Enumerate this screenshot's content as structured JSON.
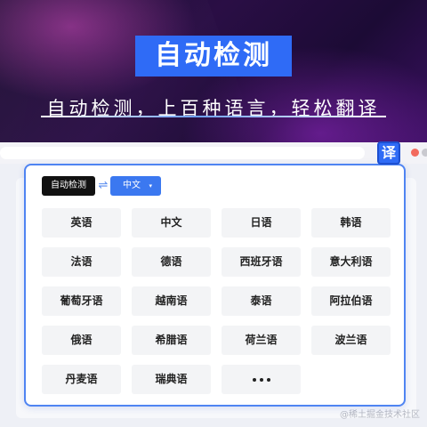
{
  "banner": {
    "headline": "自动检测",
    "subline": "自动检测，上百种语言，轻松翻译"
  },
  "toolbar": {
    "translate_button": "译"
  },
  "panel": {
    "source_language": "自动检测",
    "swap_icon": "swap-icon",
    "target_language": "中文",
    "target_chevron": "▾",
    "languages": [
      "英语",
      "中文",
      "日语",
      "韩语",
      "法语",
      "德语",
      "西班牙语",
      "意大利语",
      "葡萄牙语",
      "越南语",
      "泰语",
      "阿拉伯语",
      "俄语",
      "希腊语",
      "荷兰语",
      "波兰语",
      "丹麦语",
      "瑞典语"
    ],
    "more_icon": "ellipsis-icon"
  },
  "watermark": "@稀土掘金技术社区",
  "colors": {
    "accent": "#2f6bf6",
    "panel_border": "#4f84f2",
    "source_bg": "#111111",
    "target_bg": "#3b78f0",
    "lang_bg": "#f3f4f6"
  }
}
